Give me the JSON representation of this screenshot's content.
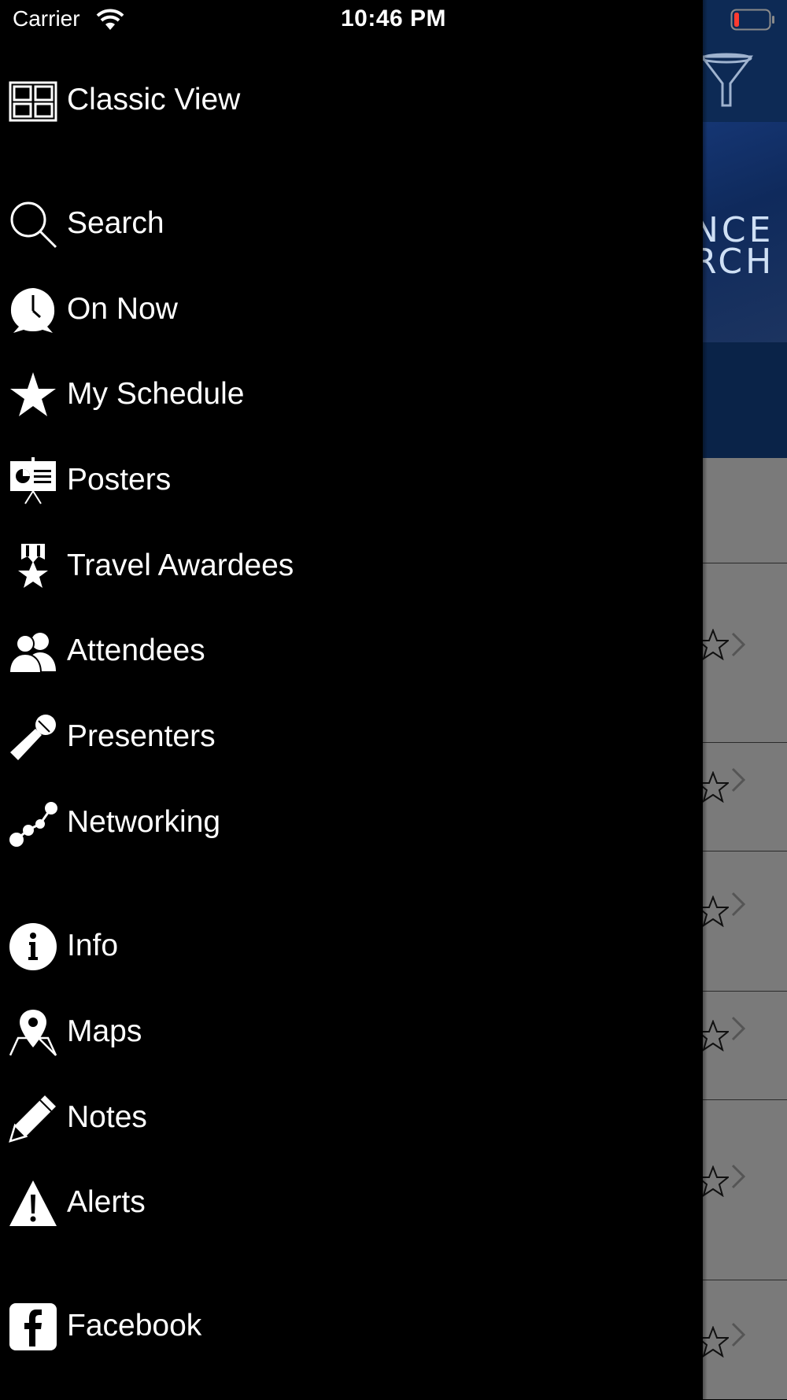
{
  "status_bar": {
    "carrier": "Carrier",
    "time": "10:46 PM",
    "battery_color": "#ff3b30"
  },
  "background_app": {
    "banner_text": "NCE\nRCH",
    "header_color": "#0d2a55",
    "list_color": "#7a7a7a"
  },
  "drawer": {
    "items": [
      {
        "label": "Classic View",
        "icon": "grid-icon"
      },
      {
        "label": "Search",
        "icon": "search-icon"
      },
      {
        "label": "On Now",
        "icon": "clock-icon"
      },
      {
        "label": "My Schedule",
        "icon": "star-icon"
      },
      {
        "label": "Posters",
        "icon": "poster-board-icon"
      },
      {
        "label": "Travel Awardees",
        "icon": "award-ribbon-icon"
      },
      {
        "label": "Attendees",
        "icon": "people-icon"
      },
      {
        "label": "Presenters",
        "icon": "microphone-icon"
      },
      {
        "label": "Networking",
        "icon": "network-nodes-icon"
      },
      {
        "label": "Info",
        "icon": "info-icon"
      },
      {
        "label": "Maps",
        "icon": "map-pin-icon"
      },
      {
        "label": "Notes",
        "icon": "pencil-icon"
      },
      {
        "label": "Alerts",
        "icon": "alert-triangle-icon"
      },
      {
        "label": "Facebook",
        "icon": "facebook-icon"
      }
    ]
  }
}
